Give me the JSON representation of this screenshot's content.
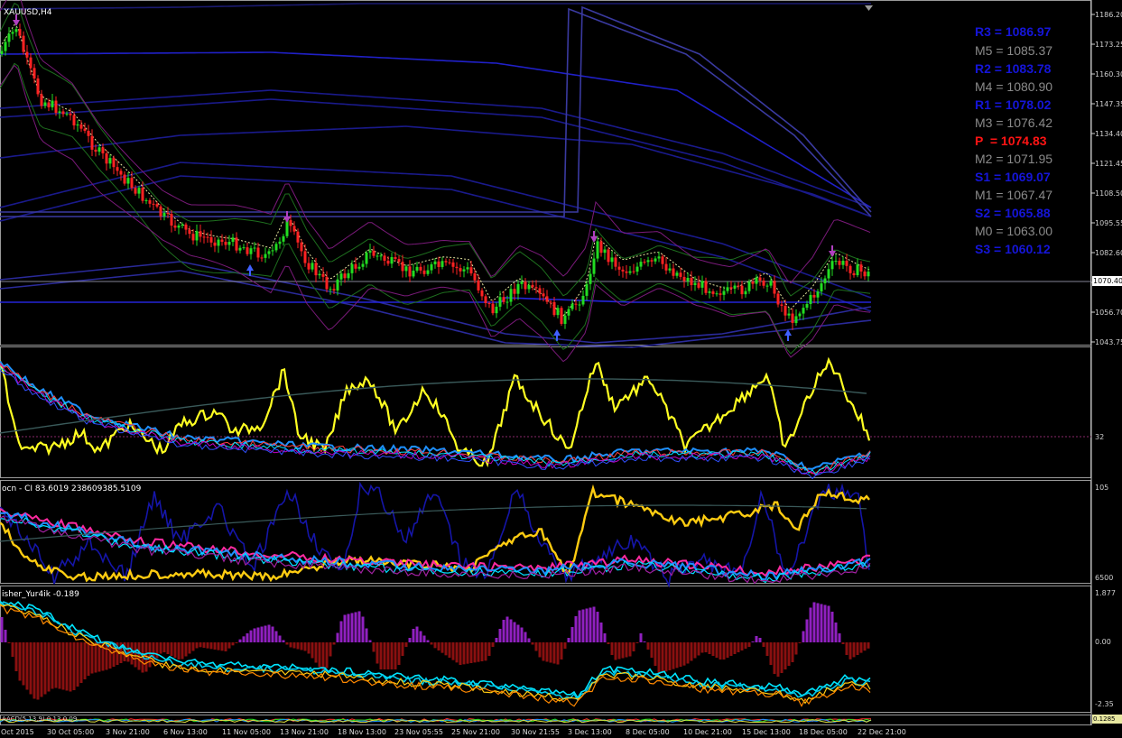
{
  "window": {
    "title": "XAUUSD,H4"
  },
  "pivots": [
    {
      "label": "R3 = 1086.97",
      "color": "blue"
    },
    {
      "label": "M5 = 1085.37",
      "color": "gray"
    },
    {
      "label": "R2 = 1083.78",
      "color": "blue"
    },
    {
      "label": "M4 = 1080.90",
      "color": "gray"
    },
    {
      "label": "R1 = 1078.02",
      "color": "blue"
    },
    {
      "label": "M3 = 1076.42",
      "color": "gray"
    },
    {
      "label": "P  = 1074.83",
      "color": "red"
    },
    {
      "label": "M2 = 1071.95",
      "color": "gray"
    },
    {
      "label": "S1 = 1069.07",
      "color": "blue"
    },
    {
      "label": "M1 = 1067.47",
      "color": "gray"
    },
    {
      "label": "S2 = 1065.88",
      "color": "blue"
    },
    {
      "label": "M0 = 1063.00",
      "color": "gray"
    },
    {
      "label": "S3 = 1060.12",
      "color": "blue"
    }
  ],
  "price_axis": [
    "1186.20",
    "1173.25",
    "1160.30",
    "1147.35",
    "1134.40",
    "1121.45",
    "1108.50",
    "1095.55",
    "1082.60",
    "1069.65",
    "1056.70",
    "1043.75"
  ],
  "current_price": "1070.40",
  "sub1": {
    "level": "32"
  },
  "sub2": {
    "header": "ocn - CI 83.6019 238609385.5109",
    "top": "105",
    "bottom": "6500"
  },
  "sub3": {
    "header": "isher_Yur4ik -0.189",
    "top": "1.877",
    "mid": "0.00",
    "bottom": "-2.35"
  },
  "sub4": {
    "header": "AACD(5,13,9) 0.13 0.09",
    "badge": "0.1285"
  },
  "time_axis": [
    "Oct 2015",
    "30 Oct 05:00",
    "3 Nov 21:00",
    "6 Nov 13:00",
    "11 Nov 05:00",
    "13 Nov 21:00",
    "18 Nov 13:00",
    "23 Nov 05:55",
    "25 Nov 21:00",
    "30 Nov 21:55",
    "3 Dec 13:00",
    "8 Dec 05:00",
    "10 Dec 21:00",
    "15 Dec 13:00",
    "18 Dec 05:00",
    "22 Dec 21:00"
  ],
  "colors": {
    "bull": "#22dd22",
    "bear": "#ff2222",
    "yellow": "#ffff22",
    "pivot_blue": "#1515d8"
  }
}
